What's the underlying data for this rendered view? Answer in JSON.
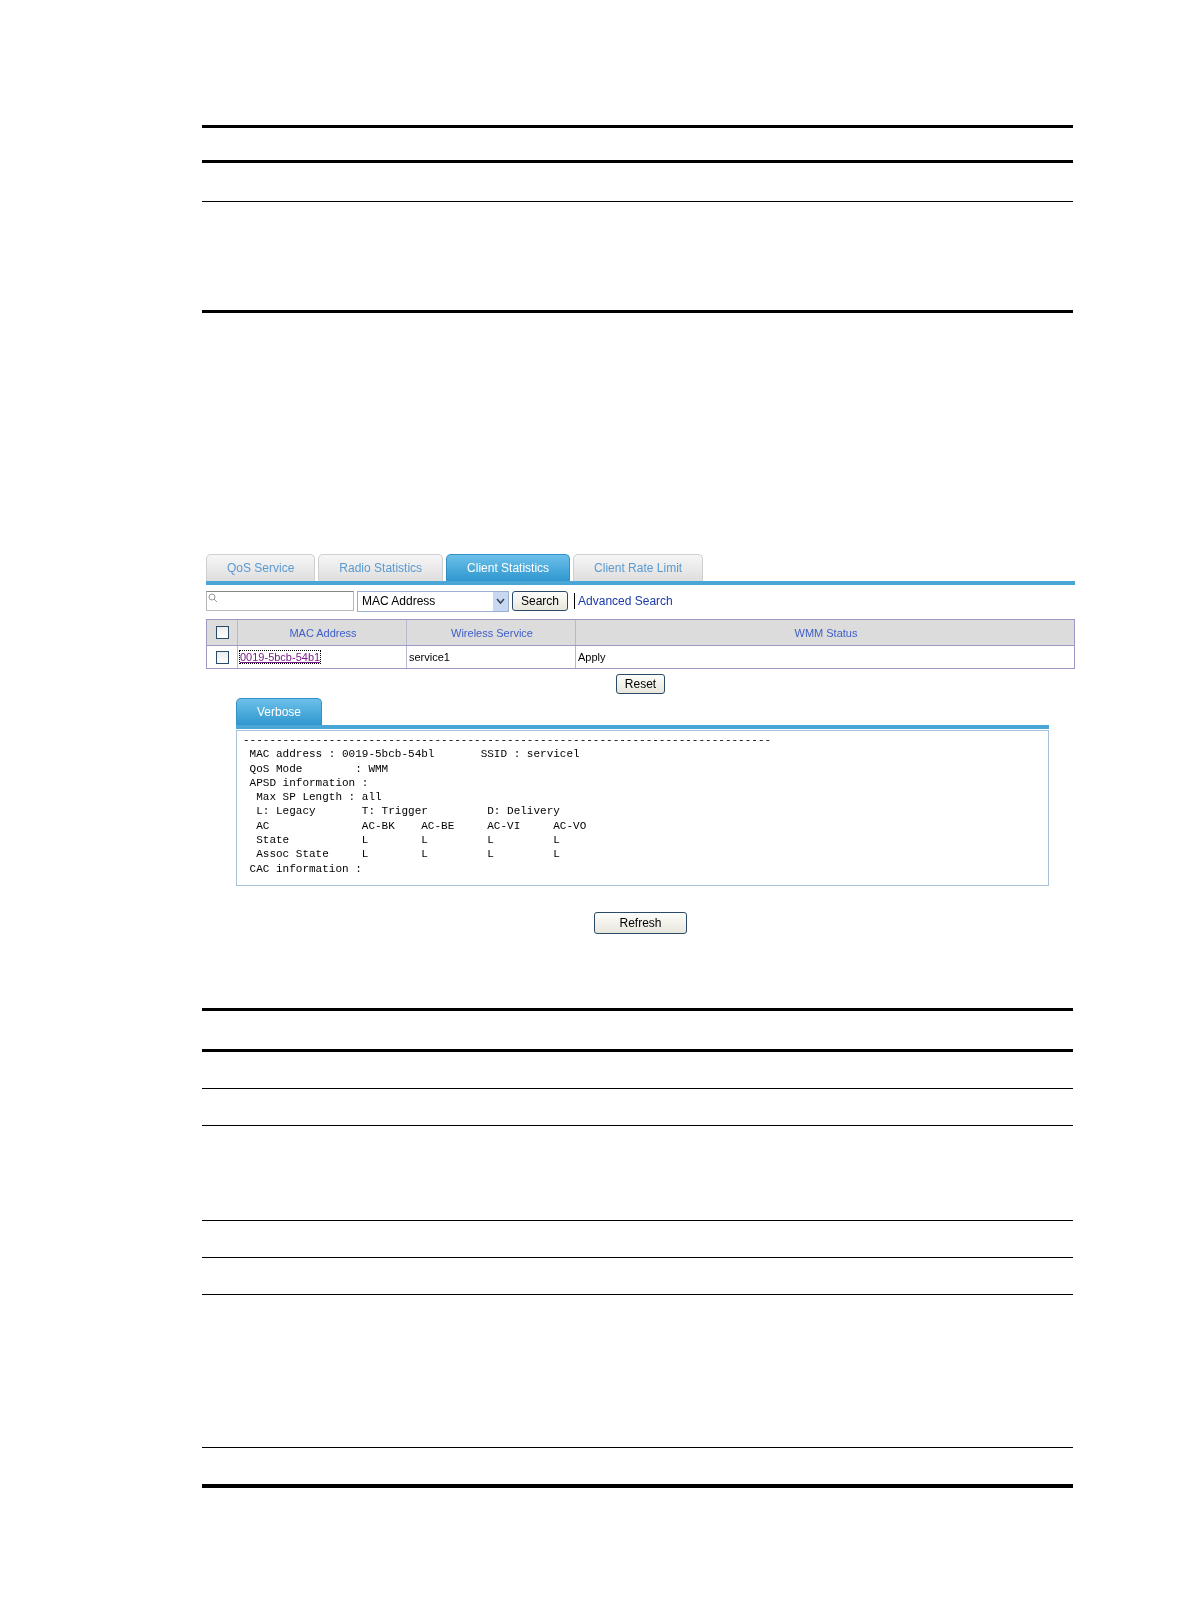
{
  "tabs": [
    {
      "label": "QoS Service",
      "selected": false
    },
    {
      "label": "Radio Statistics",
      "selected": false
    },
    {
      "label": "Client Statistics",
      "selected": true
    },
    {
      "label": "Client Rate Limit",
      "selected": false
    }
  ],
  "search": {
    "select_value": "MAC Address",
    "button": "Search",
    "link": "Advanced Search"
  },
  "table": {
    "header_checked": false,
    "columns": [
      "MAC Address",
      "Wireless Service",
      "WMM Status"
    ],
    "rows": [
      {
        "checked": false,
        "cells": [
          "0019-5bcb-54b1",
          "service1",
          "Apply"
        ]
      }
    ]
  },
  "reset_button": "Reset",
  "verbose": {
    "tab": {
      "label": "Verbose",
      "selected": true
    },
    "lines": [
      "--------------------------------------------------------------------------------",
      " MAC address : 0019-5bcb-54bl       SSID : servicel",
      " QoS Mode        : WMM",
      " APSD information :",
      "  Max SP Length : all",
      "  L: Legacy       T: Trigger         D: Delivery",
      "  AC              AC-BK    AC-BE     AC-VI     AC-VO",
      "  State           L        L         L         L",
      "  Assoc State     L        L         L         L",
      " CAC information :"
    ]
  },
  "refresh_button": "Refresh"
}
